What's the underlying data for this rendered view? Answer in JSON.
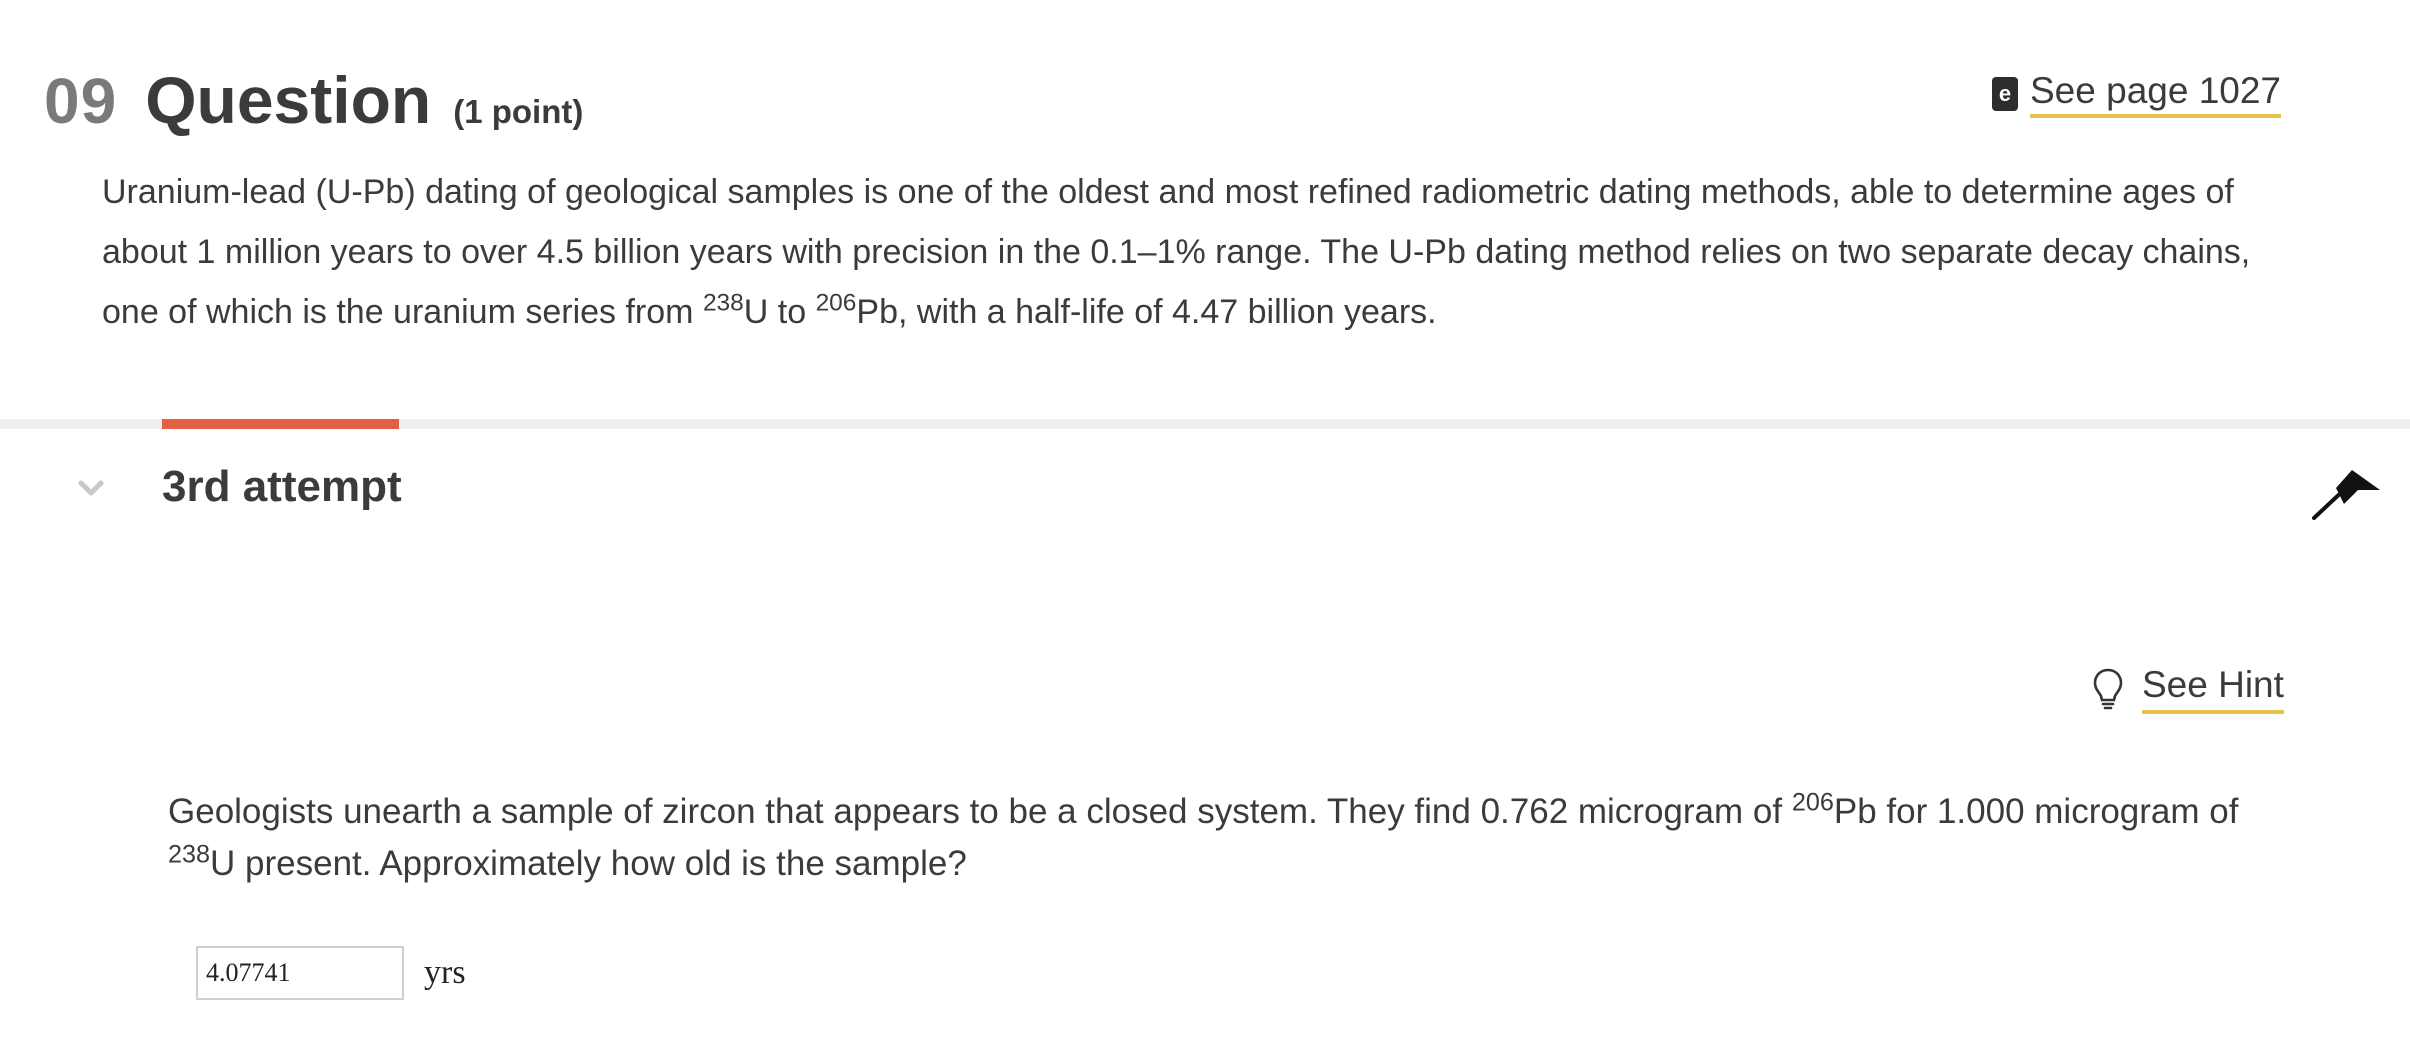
{
  "question": {
    "number": "09",
    "title": "Question",
    "points": "(1 point)"
  },
  "reference": {
    "label": "See page 1027",
    "icon": "ebook-icon"
  },
  "intro": {
    "part1": "Uranium-lead (U-Pb) dating of geological samples is one of the oldest and most refined radiometric dating methods, able to determine ages of about 1 million years to over 4.5 billion years with precision in the 0.1–1% range. The U-Pb dating method relies on two separate decay chains, one of which is the uranium series from ",
    "sup1": "238",
    "part2": "U to ",
    "sup2": "206",
    "part3": "Pb, with a half-life of 4.47 billion years."
  },
  "attempt": {
    "title": "3rd attempt",
    "accent_color": "#e35f45"
  },
  "hint": {
    "label": "See Hint",
    "icon": "lightbulb-icon"
  },
  "prompt": {
    "part1": "Geologists unearth a sample of zircon that appears to be a closed system. They find 0.762 microgram of ",
    "sup1": "206",
    "part2": "Pb for 1.000 microgram of ",
    "sup2": "238",
    "part3": "U present. Approximately how old is the sample?"
  },
  "answer": {
    "value": "4.07741",
    "unit": "yrs"
  },
  "colors": {
    "underline": "#e8c24a",
    "text": "#3b3b3b",
    "divider": "#eeeeee"
  }
}
